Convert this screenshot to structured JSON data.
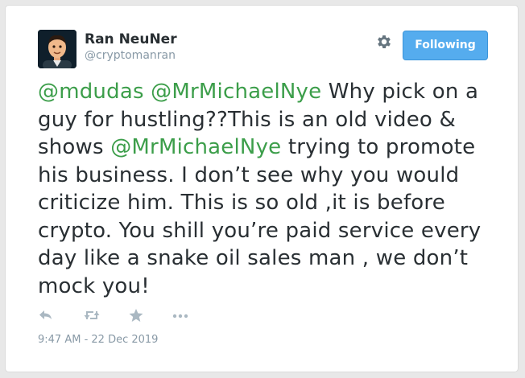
{
  "user": {
    "name": "Ran NeuNer",
    "handle": "@cryptomanran"
  },
  "follow_button": {
    "label": "Following",
    "color": "#55acee"
  },
  "tweet": {
    "segments": [
      {
        "type": "mention",
        "text": "@mdudas"
      },
      {
        "type": "text",
        "text": " "
      },
      {
        "type": "mention",
        "text": "@MrMichaelNye"
      },
      {
        "type": "text",
        "text": " Why pick on a guy for hustling??This is an old video & shows "
      },
      {
        "type": "mention",
        "text": "@MrMichaelNye"
      },
      {
        "type": "text",
        "text": " trying to promote his business. I don’t see why you would criticize him. This is so old ,it is before crypto. You shill you’re paid service every day like a snake oil sales man , we don’t mock you!"
      }
    ],
    "mention_color": "#3c9e4a",
    "timestamp": "9:47 AM - 22 Dec 2019"
  },
  "actions": {
    "icons": [
      "reply-icon",
      "retweet-icon",
      "like-star-icon",
      "more-icon"
    ]
  },
  "settings": {
    "icon": "gear-icon"
  }
}
